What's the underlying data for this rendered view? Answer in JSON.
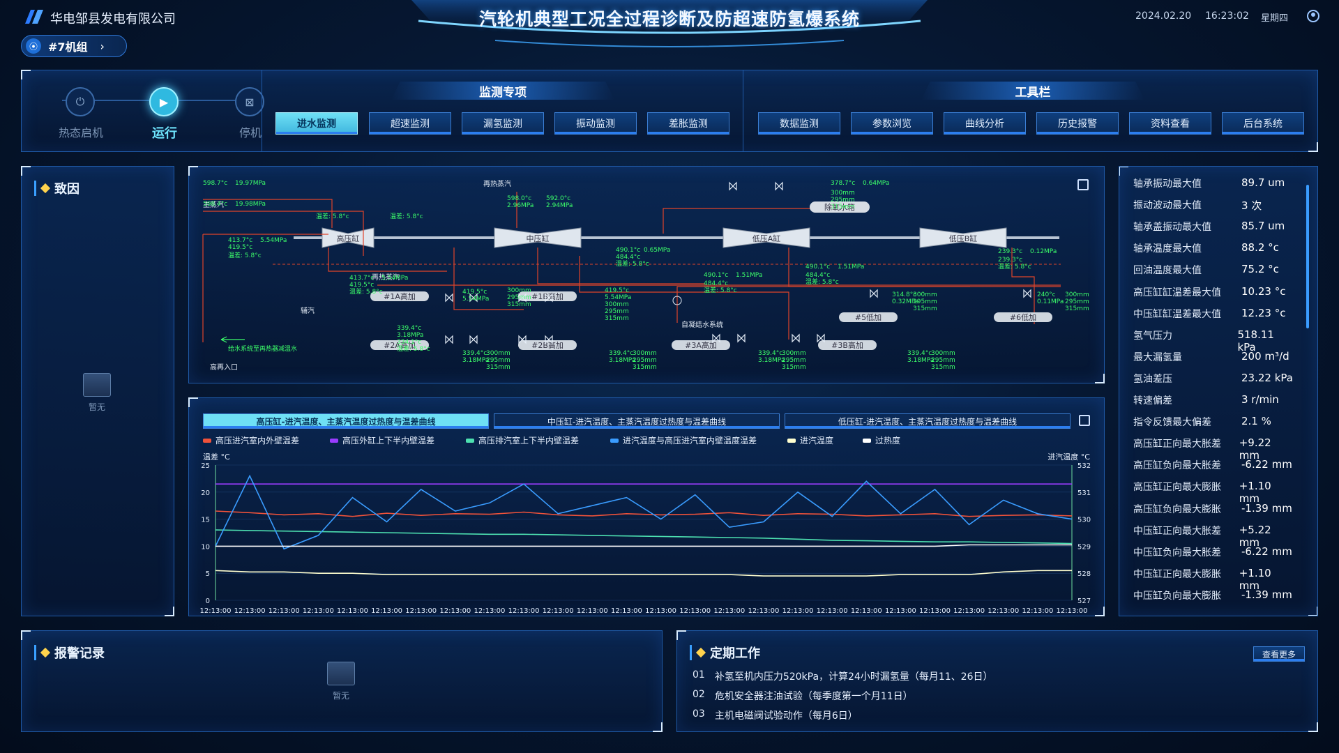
{
  "header": {
    "company": "华电邹县发电有限公司",
    "title": "汽轮机典型工况全过程诊断及防超速防氢爆系统",
    "date": "2024.02.20",
    "time": "16:23:02",
    "weekday": "星期四",
    "unit": "#7机组"
  },
  "status_steps": [
    {
      "label": "热态启机",
      "icon": "power-icon"
    },
    {
      "label": "运行",
      "icon": "play-icon"
    },
    {
      "label": "停机",
      "icon": "stop-icon"
    }
  ],
  "monitor": {
    "title": "监测专项",
    "buttons": [
      "进水监测",
      "超速监测",
      "漏氢监测",
      "振动监测",
      "差胀监测"
    ],
    "active": 0
  },
  "tools": {
    "title": "工具栏",
    "buttons": [
      "数据监测",
      "参数浏览",
      "曲线分析",
      "历史报警",
      "资料查看",
      "后台系统"
    ]
  },
  "cause": {
    "title": "致因",
    "empty_text": "暂无"
  },
  "diagram": {
    "hp": "高压缸",
    "ip": "中压缸",
    "lpa": "低压A缸",
    "lpb": "低压B缸",
    "deaerator": "除氧水箱",
    "main_steam": "主蒸汽",
    "reheat_steam": "再热蒸汽",
    "reheat_steam2": "再热蒸汽",
    "aux_steam": "辅汽",
    "condensate": "自凝结水系统",
    "feedwater_note": "给水系统至再热器减温水",
    "hp_inlet": "高再入口",
    "heaters": [
      "#1A高加",
      "#1B高加",
      "#2A高加",
      "#2B高加",
      "#3A高加",
      "#3B高加",
      "#5低加",
      "#6低加"
    ],
    "readings": [
      "598.7°c",
      "19.97MPa",
      "598.4°c",
      "19.98MPa",
      "温差: 5.8°c",
      "温差: 5.8°c",
      "413.7°c",
      "5.54MPa",
      "419.5°c",
      "温差: 5.8°c",
      "598.0°c",
      "592.0°c",
      "2.96MPa",
      "2.94MPa",
      "490.1°c",
      "0.65MPa",
      "484.4°c",
      "温差: 5.8°c",
      "378.7°c",
      "0.64MPa",
      "300mm",
      "295mm",
      "315mm",
      "239.3°c",
      "0.12MPa",
      "239.3°c",
      "温差: 5.8°c",
      "413.7°c",
      "5.54MPa",
      "419.5°c",
      "温差: 5.8°c",
      "419.5°c",
      "5.54MPa",
      "300mm",
      "295mm",
      "315mm",
      "419.5°c",
      "5.54MPa",
      "300mm",
      "295mm",
      "315mm",
      "490.1°c",
      "1.51MPa",
      "484.4°c",
      "温差: 5.8°c",
      "490.1°c",
      "1.51MPa",
      "484.4°c",
      "温差: 5.8°c",
      "314.8°c",
      "0.32MPa",
      "300mm",
      "295mm",
      "315mm",
      "240°c",
      "0.11MPa",
      "300mm",
      "295mm",
      "315mm",
      "339.4°c",
      "3.18MPa",
      "334.1°c",
      "温差: 5.8°c",
      "339.4°c",
      "3.18MPa",
      "300mm",
      "295mm",
      "315mm",
      "339.4°c",
      "3.18MPa",
      "300mm",
      "295mm",
      "315mm",
      "339.4°c",
      "3.18MPa",
      "300mm",
      "295mm",
      "315mm",
      "339.4°c",
      "3.18MPa",
      "300mm",
      "295mm",
      "315mm"
    ]
  },
  "chart_tabs": [
    "高压缸-进汽温度、主蒸汽温度过热度与温差曲线",
    "中压缸-进汽温度、主蒸汽温度过热度与温差曲线",
    "低压缸-进汽温度、主蒸汽温度过热度与温差曲线"
  ],
  "chart_data": {
    "type": "line",
    "ylabel": "温差 °C",
    "y2label": "进汽温度 °C",
    "ylim": [
      0,
      25
    ],
    "y2lim": [
      527,
      532
    ],
    "yticks": [
      "0",
      "5",
      "10",
      "15",
      "20",
      "25"
    ],
    "y2ticks": [
      "527",
      "528",
      "529",
      "530",
      "531",
      "532"
    ],
    "categories": [
      "12:13:00",
      "12:13:00",
      "12:13:00",
      "12:13:00",
      "12:13:00",
      "12:13:00",
      "12:13:00",
      "12:13:00",
      "12:13:00",
      "12:13:00",
      "12:13:00",
      "12:13:00",
      "12:13:00",
      "12:13:00",
      "12:13:00",
      "12:13:00",
      "12:13:00",
      "12:13:00",
      "12:13:00",
      "12:13:00",
      "12:13:00",
      "12:13:00",
      "12:13:00",
      "12:13:00",
      "12:13:00",
      "12:13:00"
    ],
    "series": [
      {
        "name": "高压进汽室内外壁温差",
        "color": "#f0523a",
        "axis": "left",
        "values": [
          16.5,
          16.2,
          15.8,
          16.0,
          15.5,
          16.1,
          15.7,
          16.0,
          15.9,
          16.3,
          15.8,
          15.6,
          16.0,
          15.8,
          15.9,
          16.2,
          15.7,
          16.0,
          15.9,
          15.6,
          15.8,
          16.0,
          15.5,
          15.7,
          15.8,
          15.6
        ]
      },
      {
        "name": "高压外缸上下半内壁温差",
        "color": "#9a3cff",
        "axis": "left",
        "values": [
          21.5,
          21.5,
          21.5,
          21.5,
          21.5,
          21.5,
          21.5,
          21.5,
          21.5,
          21.5,
          21.5,
          21.5,
          21.5,
          21.5,
          21.5,
          21.5,
          21.5,
          21.5,
          21.5,
          21.5,
          21.5,
          21.5,
          21.5,
          21.5,
          21.5,
          21.5
        ]
      },
      {
        "name": "高压排汽室上下半内壁温差",
        "color": "#4de0b0",
        "axis": "left",
        "values": [
          13,
          12.9,
          12.8,
          12.7,
          12.6,
          12.5,
          12.4,
          12.3,
          12.2,
          12.2,
          12.1,
          12.0,
          11.9,
          11.8,
          11.7,
          11.6,
          11.5,
          11.3,
          11.1,
          11.0,
          10.9,
          10.8,
          10.8,
          10.7,
          10.6,
          10.5
        ]
      },
      {
        "name": "进汽温度与高压进汽室内壁温度温差",
        "color": "#3a9cff",
        "axis": "left",
        "values": [
          10,
          23,
          9.5,
          12,
          19,
          14.5,
          20.5,
          16.5,
          18,
          21.5,
          16,
          17.5,
          19,
          15,
          19.5,
          13.5,
          14.5,
          20,
          15.5,
          22,
          16,
          20.5,
          14,
          18.5,
          16,
          15
        ]
      },
      {
        "name": "进汽温度",
        "color": "#ffffd0",
        "axis": "right",
        "values": [
          528.1,
          528.05,
          528.05,
          528.0,
          528.0,
          527.95,
          527.95,
          527.95,
          527.95,
          527.95,
          527.95,
          527.95,
          527.95,
          527.95,
          527.95,
          527.95,
          527.9,
          527.9,
          527.9,
          527.9,
          527.95,
          527.95,
          527.95,
          528.05,
          528.1,
          528.1
        ]
      },
      {
        "name": "过热度",
        "color": "#ffffff",
        "axis": "right",
        "values": [
          529.0,
          529.0,
          529.0,
          529.0,
          529.0,
          529.0,
          529.0,
          529.0,
          529.0,
          529.0,
          529.0,
          529.0,
          529.0,
          529.0,
          529.0,
          529.0,
          529.0,
          529.0,
          529.0,
          529.0,
          529.0,
          529.0,
          529.05,
          529.05,
          529.05,
          529.05
        ]
      }
    ]
  },
  "metrics": [
    {
      "k": "轴承振动最大值",
      "v": "89.7",
      "u": "um"
    },
    {
      "k": "振动波动最大值",
      "v": "3",
      "u": "次"
    },
    {
      "k": "轴承盖振动最大值",
      "v": "85.7",
      "u": "um"
    },
    {
      "k": "轴承温度最大值",
      "v": "88.2",
      "u": "°c"
    },
    {
      "k": "回油温度最大值",
      "v": "75.2",
      "u": "°c"
    },
    {
      "k": "高压缸缸温差最大值",
      "v": "10.23",
      "u": "°c"
    },
    {
      "k": "中压缸缸温差最大值",
      "v": "12.23",
      "u": "°c"
    },
    {
      "k": "氢气压力",
      "v": "518.11",
      "u": "kPa"
    },
    {
      "k": "最大漏氢量",
      "v": "200",
      "u": "m³/d"
    },
    {
      "k": "氢油差压",
      "v": "23.22",
      "u": "kPa"
    },
    {
      "k": "转速偏差",
      "v": "3",
      "u": "r/min"
    },
    {
      "k": "指令反馈最大偏差",
      "v": "2.1",
      "u": "%"
    },
    {
      "k": "高压缸正向最大胀差",
      "v": "+9.22",
      "u": "mm"
    },
    {
      "k": "高压缸负向最大胀差",
      "v": "-6.22",
      "u": "mm"
    },
    {
      "k": "高压缸正向最大膨胀",
      "v": "+1.10",
      "u": "mm"
    },
    {
      "k": "高压缸负向最大膨胀",
      "v": "-1.39",
      "u": "mm"
    },
    {
      "k": "中压缸正向最大胀差",
      "v": "+5.22",
      "u": "mm"
    },
    {
      "k": "中压缸负向最大胀差",
      "v": "-6.22",
      "u": "mm"
    },
    {
      "k": "中压缸正向最大膨胀",
      "v": "+1.10",
      "u": "mm"
    },
    {
      "k": "中压缸负向最大膨胀",
      "v": "-1.39",
      "u": "mm"
    }
  ],
  "alarm": {
    "title": "报警记录",
    "empty_text": "暂无"
  },
  "work": {
    "title": "定期工作",
    "more": "查看更多",
    "items": [
      {
        "no": "01",
        "text": "补氢至机内压力520kPa，计算24小时漏氢量（每月11、26日）"
      },
      {
        "no": "02",
        "text": "危机安全器注油试验（每季度第一个月11日）"
      },
      {
        "no": "03",
        "text": "主机电磁阀试验动作（每月6日）"
      }
    ]
  }
}
